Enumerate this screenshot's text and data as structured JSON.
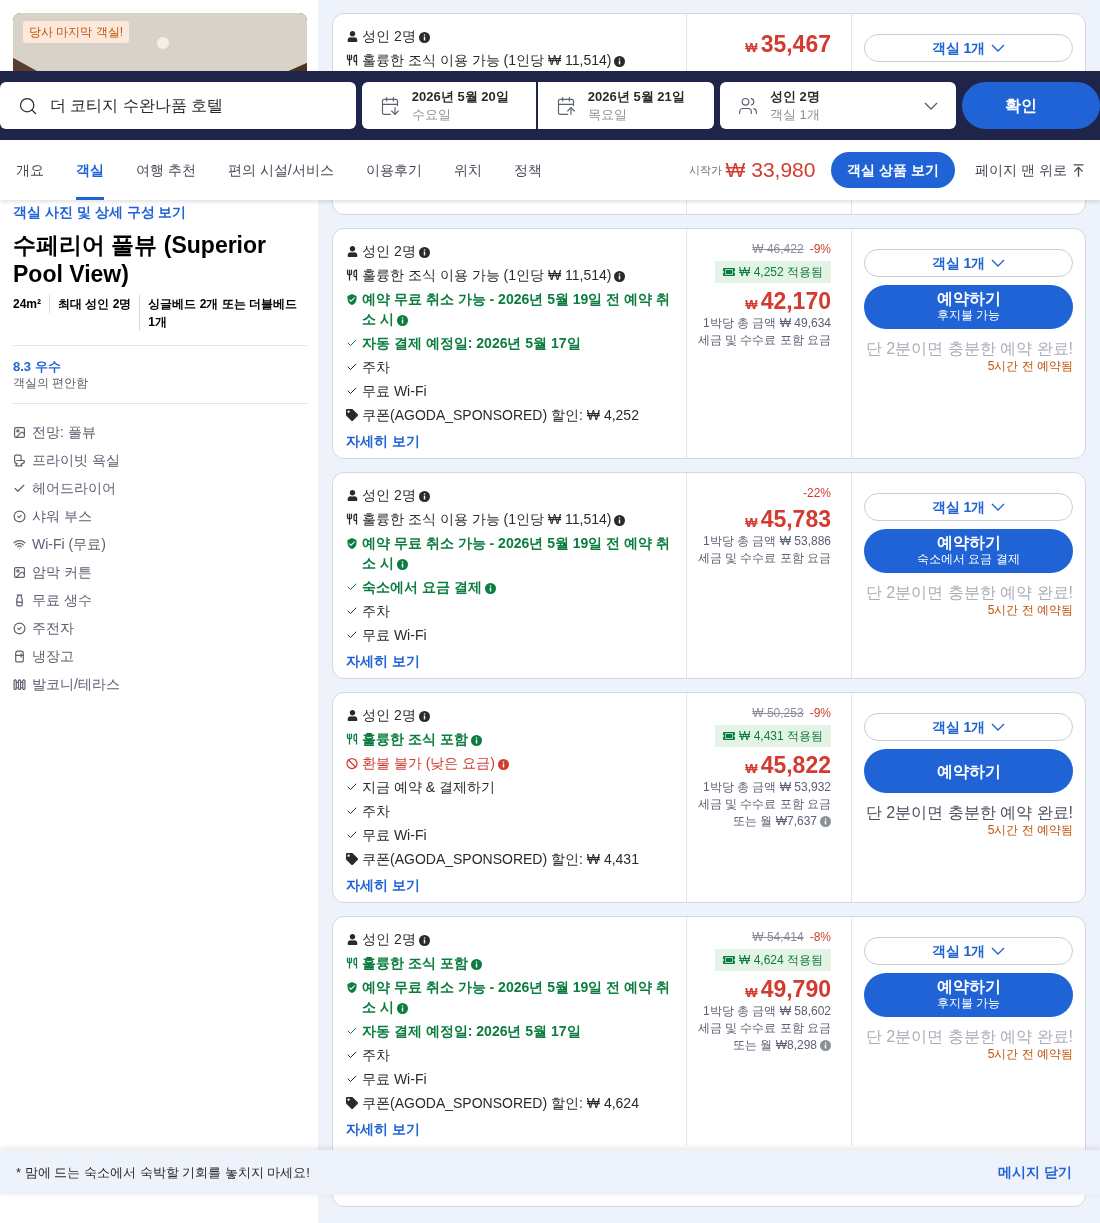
{
  "header": {
    "search": {
      "value": "더 코티지 수완나품 호텔"
    },
    "check_in": {
      "date": "2026년 5월 20일",
      "weekday": "수요일"
    },
    "check_out": {
      "date": "2026년 5월 21일",
      "weekday": "목요일"
    },
    "guests": {
      "adults": "성인 2명",
      "rooms": "객실 1개"
    },
    "confirm_button": "확인"
  },
  "nav": {
    "tabs": [
      {
        "label": "개요",
        "selected": false
      },
      {
        "label": "객실",
        "selected": true
      },
      {
        "label": "여행 추천",
        "selected": false
      },
      {
        "label": "편의 시설/서비스",
        "selected": false
      },
      {
        "label": "이용후기",
        "selected": false
      },
      {
        "label": "위치",
        "selected": false
      },
      {
        "label": "정책",
        "selected": false
      }
    ],
    "from_label": "시작가",
    "from_price": "₩ 33,980",
    "rooms_button": "객실 상품 보기",
    "back_to_top": "페이지 맨 위로"
  },
  "room": {
    "photo": {
      "kind": "picture",
      "badge": "당사 마지막 객실!"
    },
    "photos_link": "객실 사진 및 상세 구성 보기",
    "name": "수페리어 풀뷰 (Superior Pool View)",
    "specs": [
      "24m²",
      "최대 성인 2명",
      "싱글베드 2개 또는 더블베드 1개"
    ],
    "rating": "8.3 우수",
    "rating_label": "객실의 편안함",
    "amenities": [
      {
        "kind": "view",
        "text": "전망: 풀뷰"
      },
      {
        "kind": "toilet",
        "text": "프라이빗 욕실"
      },
      {
        "kind": "check",
        "text": "헤어드라이어"
      },
      {
        "kind": "check_circle",
        "text": "샤워 부스"
      },
      {
        "kind": "wifi",
        "text": "Wi-Fi (무료)"
      },
      {
        "kind": "view",
        "text": "암막 커튼"
      },
      {
        "kind": "bottle",
        "text": "무료 생수"
      },
      {
        "kind": "check_circle",
        "text": "주전자"
      },
      {
        "kind": "fridge",
        "text": "냉장고"
      },
      {
        "kind": "balcony",
        "text": "발코니/테라스"
      }
    ]
  },
  "offers": [
    {
      "features": [
        {
          "kind": "occupancy",
          "text": "성인 2명",
          "info": true
        },
        {
          "kind": "breakfast",
          "text": "훌륭한 조식 이용 가능 (1인당 ₩ 11,514)",
          "info": true
        }
      ],
      "currency": "₩",
      "price": "35,467",
      "room_select": "객실 1개"
    },
    {
      "features": [
        {
          "kind": "occupancy",
          "text": "성인 2명",
          "info": true
        },
        {
          "kind": "breakfast",
          "text": "훌륭한 조식 이용 가능 (1인당 ₩ 11,514)",
          "info": true
        },
        {
          "kind": "free_cancel",
          "text": "예약 무료 취소 가능 - 2026년 5월 19일 전 예약 취소 시",
          "info": true
        },
        {
          "kind": "check_highlight",
          "text": "자동 결제 예정일: 2026년 5월 17일",
          "info": false
        },
        {
          "kind": "check",
          "text": "주차",
          "info": false
        },
        {
          "kind": "check",
          "text": "무료 Wi-Fi",
          "info": false
        },
        {
          "kind": "coupon",
          "text": "쿠폰(AGODA_SPONSORED) 할인: ₩ 4,252",
          "info": false
        }
      ],
      "details": "자세히 보기",
      "original": "₩ 46,422",
      "discount": "-9%",
      "coupon": "₩ 4,252 적용됨",
      "currency": "₩",
      "price": "42,170",
      "total": "1박당 총 금액 ₩ 49,634",
      "tax_note": "세금 및 수수료 포함 요금",
      "room_select": "객실 1개",
      "book": "예약하기",
      "book_note": "후지불 가능",
      "urgency": "단 2분이면 충분한 예약 완료!",
      "urgency_emphasized": false,
      "booked": "5시간 전 예약됨"
    },
    {
      "features": [
        {
          "kind": "occupancy",
          "text": "성인 2명",
          "info": true
        },
        {
          "kind": "breakfast",
          "text": "훌륭한 조식 이용 가능 (1인당 ₩ 11,514)",
          "info": true
        },
        {
          "kind": "free_cancel",
          "text": "예약 무료 취소 가능 - 2026년 5월 19일 전 예약 취소 시",
          "info": true
        },
        {
          "kind": "check_highlight",
          "text": "숙소에서 요금 결제",
          "info": true
        },
        {
          "kind": "check",
          "text": "주차",
          "info": false
        },
        {
          "kind": "check",
          "text": "무료 Wi-Fi",
          "info": false
        }
      ],
      "details": "자세히 보기",
      "discount": "-22%",
      "currency": "₩",
      "price": "45,783",
      "total": "1박당 총 금액 ₩ 53,886",
      "tax_note": "세금 및 수수료 포함 요금",
      "room_select": "객실 1개",
      "book": "예약하기",
      "book_note": "숙소에서 요금 결제",
      "urgency": "단 2분이면 충분한 예약 완료!",
      "urgency_emphasized": false,
      "booked": "5시간 전 예약됨"
    },
    {
      "features": [
        {
          "kind": "occupancy",
          "text": "성인 2명",
          "info": true
        },
        {
          "kind": "breakfast_included",
          "text": "훌륭한 조식 포함",
          "info": true
        },
        {
          "kind": "non_refundable",
          "text": "환불 불가 (낮은 요금)",
          "info": true
        },
        {
          "kind": "check",
          "text": "지금 예약 & 결제하기",
          "info": false
        },
        {
          "kind": "check",
          "text": "주차",
          "info": false
        },
        {
          "kind": "check",
          "text": "무료 Wi-Fi",
          "info": false
        },
        {
          "kind": "coupon",
          "text": "쿠폰(AGODA_SPONSORED) 할인: ₩ 4,431",
          "info": false
        }
      ],
      "details": "자세히 보기",
      "original": "₩ 50,253",
      "discount": "-9%",
      "coupon": "₩ 4,431 적용됨",
      "currency": "₩",
      "price": "45,822",
      "total": "1박당 총 금액 ₩ 53,932",
      "tax_note": "세금 및 수수료 포함 요금",
      "installment": "또는 월 ₩7,637",
      "room_select": "객실 1개",
      "book": "예약하기",
      "urgency": "단 2분이면 충분한 예약 완료!",
      "urgency_emphasized": true,
      "booked": "5시간 전 예약됨"
    },
    {
      "features": [
        {
          "kind": "occupancy",
          "text": "성인 2명",
          "info": true
        },
        {
          "kind": "breakfast_included",
          "text": "훌륭한 조식 포함",
          "info": true
        },
        {
          "kind": "free_cancel",
          "text": "예약 무료 취소 가능 - 2026년 5월 19일 전 예약 취소 시",
          "info": true
        },
        {
          "kind": "check_highlight",
          "text": "자동 결제 예정일: 2026년 5월 17일",
          "info": false
        },
        {
          "kind": "check",
          "text": "주차",
          "info": false
        },
        {
          "kind": "check",
          "text": "무료 Wi-Fi",
          "info": false
        },
        {
          "kind": "coupon",
          "text": "쿠폰(AGODA_SPONSORED) 할인: ₩ 4,624",
          "info": false
        }
      ],
      "details": "자세히 보기",
      "original": "₩ 54,414",
      "discount": "-8%",
      "coupon": "₩ 4,624 적용됨",
      "currency": "₩",
      "price": "49,790",
      "total": "1박당 총 금액 ₩ 58,602",
      "tax_note": "세금 및 수수료 포함 요금",
      "installment": "또는 월 ₩8,298",
      "room_select": "객실 1개",
      "book": "예약하기",
      "book_note": "후지불 가능",
      "urgency": "단 2분이면 충분한 예약 완료!",
      "urgency_emphasized": false,
      "booked": "5시간 전 예약됨"
    }
  ],
  "notice": {
    "text": "* 맘에 드는 숙소에서 숙박할 기회를 놓치지 마세요!",
    "close": "메시지 닫기"
  }
}
